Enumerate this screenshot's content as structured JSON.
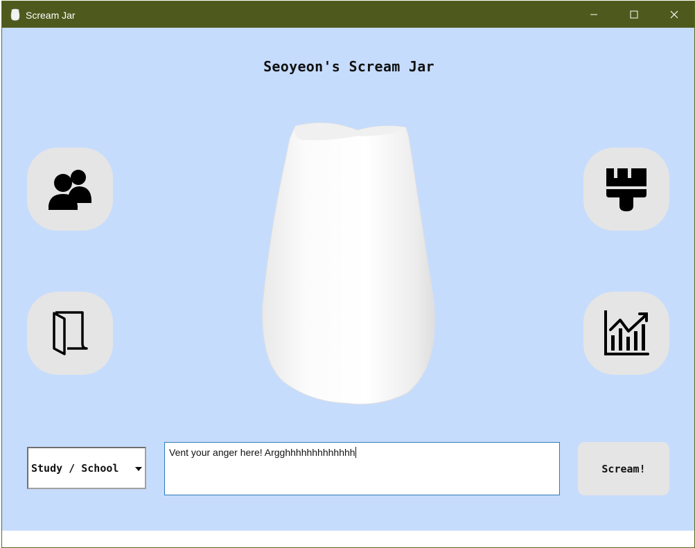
{
  "window": {
    "title": "Scream Jar",
    "controls": [
      "minimize",
      "maximize",
      "close"
    ]
  },
  "main": {
    "heading": "Seoyeon's Scream Jar",
    "jar_image": "white-jar"
  },
  "side_buttons": [
    {
      "icon": "users-icon"
    },
    {
      "icon": "door-icon"
    },
    {
      "icon": "paintbrush-icon"
    },
    {
      "icon": "bar-chart-icon"
    }
  ],
  "form": {
    "category_selected": "Study / School",
    "vent_text": "Vent your anger here! Argghhhhhhhhhhhhh",
    "scream_label": "Scream!"
  },
  "colors": {
    "titlebar": "#4e591d",
    "background": "#c6dcfd",
    "button_bg": "#e5e5e5"
  }
}
